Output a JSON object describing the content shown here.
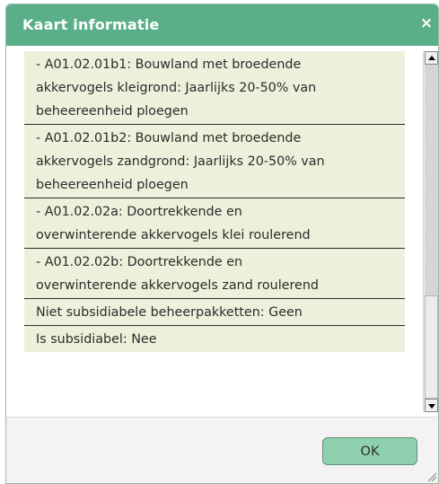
{
  "dialog": {
    "title": "Kaart informatie",
    "close_symbol": "×",
    "ok_label": "OK"
  },
  "rows": [
    {
      "lines": [
        "- A01.02.01b1: Bouwland met broedende",
        "akkervogels kleigrond: Jaarlijks 20-50% van",
        "beheereenheid ploegen"
      ]
    },
    {
      "lines": [
        "- A01.02.01b2: Bouwland met broedende",
        "akkervogels zandgrond: Jaarlijks 20-50% van",
        "beheereenheid ploegen"
      ]
    },
    {
      "lines": [
        "- A01.02.02a: Doortrekkende en",
        "overwinterende akkervogels klei roulerend"
      ]
    },
    {
      "lines": [
        "- A01.02.02b: Doortrekkende en",
        "overwinterende akkervogels zand roulerend"
      ]
    },
    {
      "lines": [
        "Niet subsidiabele beheerpakketten: Geen"
      ]
    },
    {
      "lines": [
        "Is subsidiabel: Nee"
      ]
    }
  ],
  "icons": {
    "close": "close-icon",
    "scroll_up": "arrow-up-icon",
    "scroll_down": "arrow-down-icon",
    "resize": "resize-grip-icon"
  },
  "colors": {
    "titlebar": "#5aaf89",
    "row_background": "#eff0dc",
    "ok_button": "#8fd0ae"
  }
}
